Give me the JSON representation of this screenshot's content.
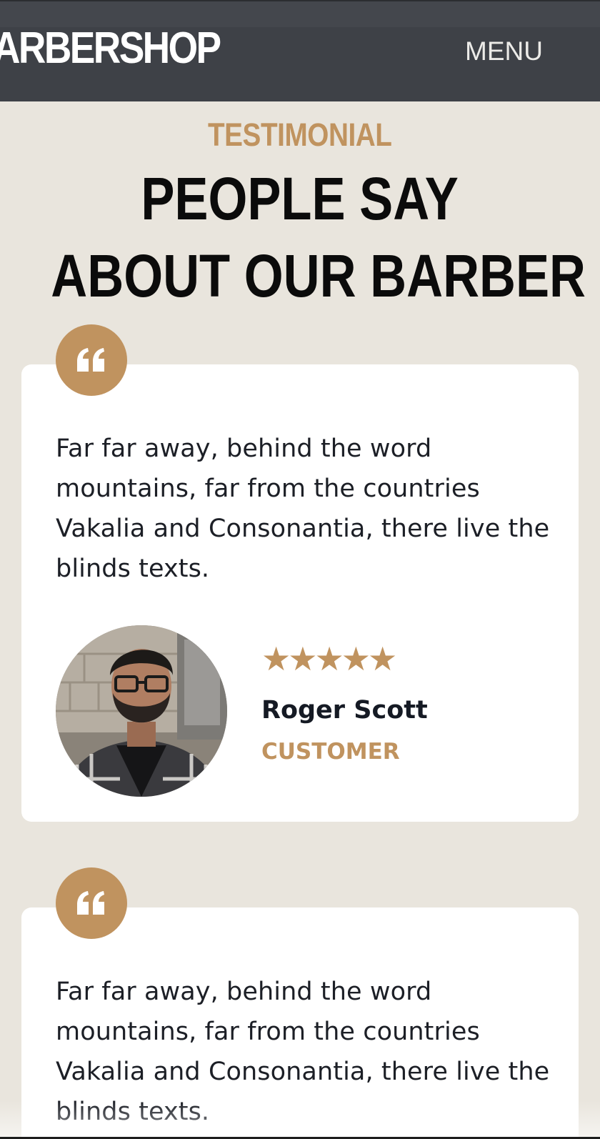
{
  "header": {
    "logo": "ARBERSHOP",
    "menu_label": "MENU",
    "background": "#3e4147"
  },
  "section": {
    "eyebrow": "TESTIMONIAL",
    "title_line1": "PEOPLE SAY",
    "title_line2": "ABOUT OUR BARBER",
    "accent": "#c0935f",
    "background": "#e9e5dd"
  },
  "testimonials": [
    {
      "icon": "quote-icon",
      "text": "Far far away, behind the word mountains, far from the countries Vakalia and Consonantia, there live the blinds texts.",
      "stars": "★★★★★",
      "rating": 5,
      "name": "Roger Scott",
      "role": "CUSTOMER",
      "avatar_icon": "customer-avatar"
    },
    {
      "icon": "quote-icon",
      "text": "Far far away, behind the word mountains, far from the countries Vakalia and Consonantia, there live the blinds texts."
    }
  ]
}
